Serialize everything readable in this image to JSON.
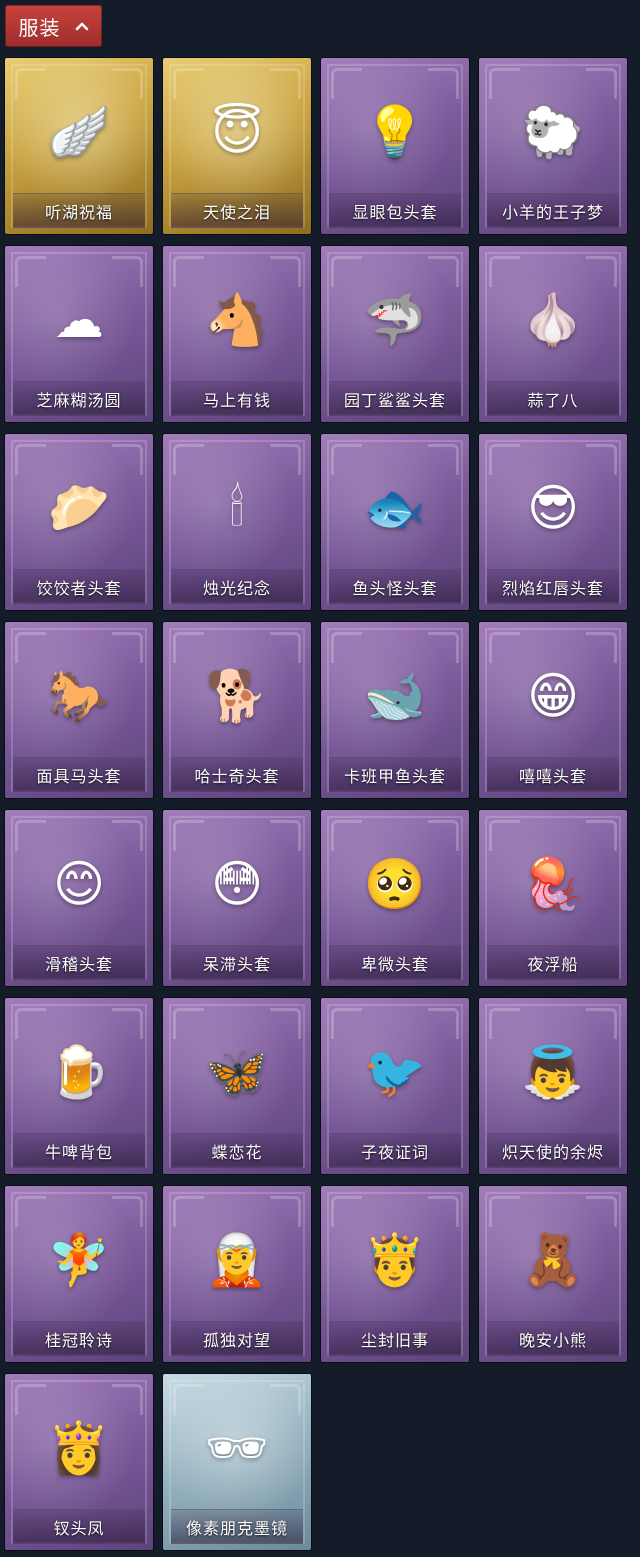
{
  "header": {
    "title": "服装",
    "toggle_icon": "chevron-up-icon"
  },
  "colors": {
    "header_tab": "#b73a36",
    "background": "#141c29",
    "card_purple": "#8a68a8",
    "card_gold": "#d2ae4c",
    "card_blue": "#a9c2cf"
  },
  "items": [
    {
      "label": "听湖祝福",
      "icon": "wing-doll-icon",
      "glyph": "🪽",
      "rarity": "gold"
    },
    {
      "label": "天使之泪",
      "icon": "angel-doll-icon",
      "glyph": "😇",
      "rarity": "gold"
    },
    {
      "label": "显眼包头套",
      "icon": "crowned-bulb-head-icon",
      "glyph": "💡",
      "rarity": "purple"
    },
    {
      "label": "小羊的王子梦",
      "icon": "sheep-crown-head-icon",
      "glyph": "🐑",
      "rarity": "purple"
    },
    {
      "label": "芝麻糊汤圆",
      "icon": "rice-ball-head-icon",
      "glyph": "☁",
      "rarity": "purple"
    },
    {
      "label": "马上有钱",
      "icon": "red-horse-head-icon",
      "glyph": "🐴",
      "rarity": "purple"
    },
    {
      "label": "园丁鲨鲨头套",
      "icon": "shark-head-icon",
      "glyph": "🦈",
      "rarity": "purple"
    },
    {
      "label": "蒜了八",
      "icon": "garlic-head-icon",
      "glyph": "🧄",
      "rarity": "purple"
    },
    {
      "label": "饺饺者头套",
      "icon": "dumpling-head-icon",
      "glyph": "🥟",
      "rarity": "purple"
    },
    {
      "label": "烛光纪念",
      "icon": "candle-head-icon",
      "glyph": "🕯",
      "rarity": "purple"
    },
    {
      "label": "鱼头怪头套",
      "icon": "fish-head-icon",
      "glyph": "🐟",
      "rarity": "purple"
    },
    {
      "label": "烈焰红唇头套",
      "icon": "yellow-sunglasses-head-icon",
      "glyph": "😎",
      "rarity": "purple"
    },
    {
      "label": "面具马头套",
      "icon": "horse-mask-icon",
      "glyph": "🐎",
      "rarity": "purple"
    },
    {
      "label": "哈士奇头套",
      "icon": "husky-head-icon",
      "glyph": "🐕",
      "rarity": "purple"
    },
    {
      "label": "卡班甲鱼头套",
      "icon": "gray-fish-head-icon",
      "glyph": "🐋",
      "rarity": "purple"
    },
    {
      "label": "嘻嘻头套",
      "icon": "grin-emoji-head-icon",
      "glyph": "😁",
      "rarity": "purple"
    },
    {
      "label": "滑稽头套",
      "icon": "funny-emoji-head-icon",
      "glyph": "😊",
      "rarity": "purple"
    },
    {
      "label": "呆滞头套",
      "icon": "dazed-emoji-head-icon",
      "glyph": "😳",
      "rarity": "purple"
    },
    {
      "label": "卑微头套",
      "icon": "humble-emoji-head-icon",
      "glyph": "🥺",
      "rarity": "purple"
    },
    {
      "label": "夜浮船",
      "icon": "jellyfish-icon",
      "glyph": "🪼",
      "rarity": "purple"
    },
    {
      "label": "牛啤背包",
      "icon": "beer-barrel-backpack-icon",
      "glyph": "🍺",
      "rarity": "purple"
    },
    {
      "label": "蝶恋花",
      "icon": "butterfly-wreath-icon",
      "glyph": "🦋",
      "rarity": "purple"
    },
    {
      "label": "子夜证词",
      "icon": "crow-doll-icon",
      "glyph": "🐦",
      "rarity": "purple"
    },
    {
      "label": "炽天使的余烬",
      "icon": "angel-girl-doll-icon",
      "glyph": "👼",
      "rarity": "purple"
    },
    {
      "label": "桂冠聆诗",
      "icon": "laurel-charm-icon",
      "glyph": "🧚",
      "rarity": "purple"
    },
    {
      "label": "孤独对望",
      "icon": "lonely-charm-icon",
      "glyph": "🧝",
      "rarity": "purple"
    },
    {
      "label": "尘封旧事",
      "icon": "crowned-boy-charm-icon",
      "glyph": "🤴",
      "rarity": "purple"
    },
    {
      "label": "晚安小熊",
      "icon": "bear-charm-icon",
      "glyph": "🧸",
      "rarity": "purple"
    },
    {
      "label": "钗头凤",
      "icon": "phoenix-crown-doll-icon",
      "glyph": "👸",
      "rarity": "purple"
    },
    {
      "label": "像素朋克墨镜",
      "icon": "pixel-sunglasses-icon",
      "glyph": "🕶",
      "rarity": "blue"
    }
  ]
}
